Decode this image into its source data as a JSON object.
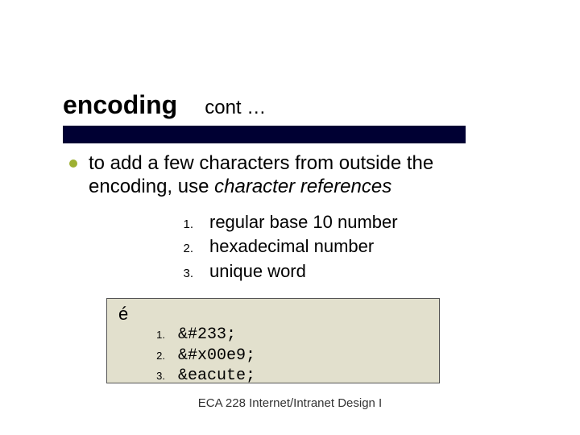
{
  "title": {
    "main": "encoding",
    "cont": "cont …"
  },
  "bullet1": {
    "pre": "to add a few characters from outside the encoding, use ",
    "em": "character references"
  },
  "sub1": [
    {
      "n": "1.",
      "t": "regular base 10 number"
    },
    {
      "n": "2.",
      "t": "hexadecimal number"
    },
    {
      "n": "3.",
      "t": "unique word"
    }
  ],
  "box": {
    "char": "é",
    "items": [
      {
        "n": "1.",
        "t": "&#233;"
      },
      {
        "n": "2.",
        "t": "&#x00e9;"
      },
      {
        "n": "3.",
        "t": "&eacute;"
      }
    ]
  },
  "footer": "ECA 228  Internet/Intranet Design I"
}
